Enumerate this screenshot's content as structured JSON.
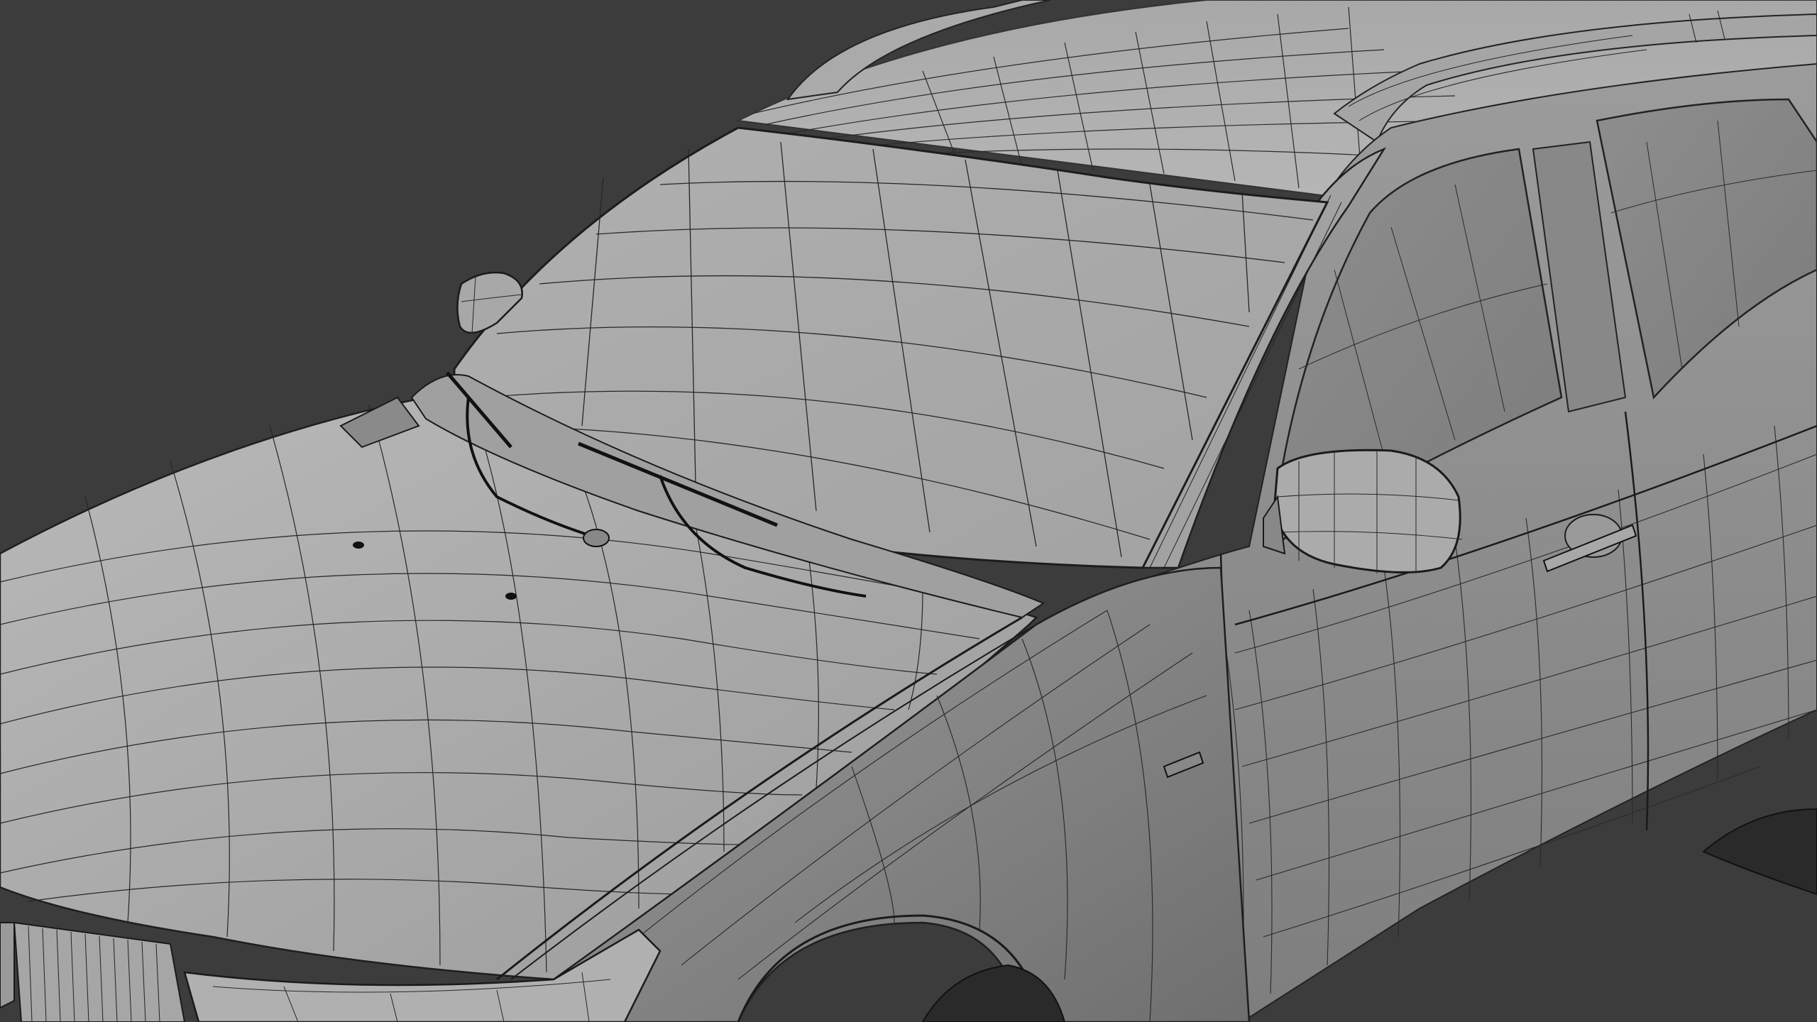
{
  "viewport": {
    "background": "#3c3c3c",
    "subject": "car-wireframe-model"
  },
  "colors": {
    "body_light": "#b4b4b4",
    "body_mid": "#9a9a9a",
    "body_dark": "#7a7a7a",
    "glass": "#a6a6a6",
    "wire": "#1e1e1e",
    "tire": "#2a2a2a"
  }
}
